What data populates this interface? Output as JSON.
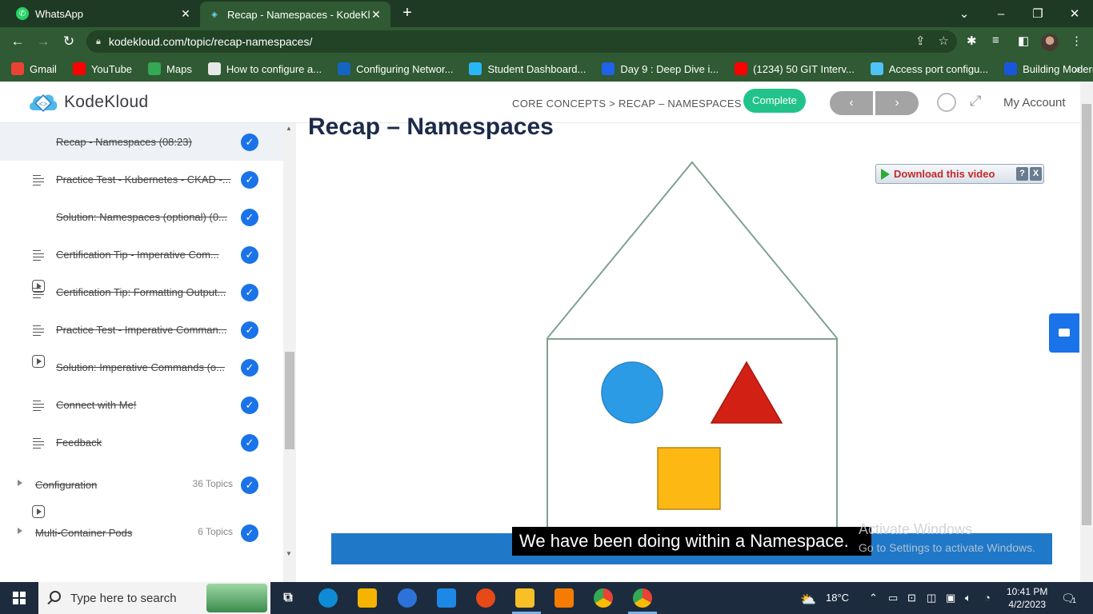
{
  "browser": {
    "tabs": [
      {
        "title": "WhatsApp",
        "icon": "whatsapp-icon",
        "active": false
      },
      {
        "title": "Recap - Namespaces - KodeKloud",
        "icon": "kodekloud-icon",
        "active": true
      }
    ],
    "url": "kodekloud.com/topic/recap-namespaces/",
    "bookmarks": [
      {
        "label": "Gmail",
        "icon": "gmail-icon",
        "color": "#ea4335"
      },
      {
        "label": "YouTube",
        "icon": "youtube-icon",
        "color": "#ff0000"
      },
      {
        "label": "Maps",
        "icon": "maps-icon",
        "color": "#34a853"
      },
      {
        "label": "How to configure a...",
        "icon": "bookmark-icon",
        "color": "#e8e8e8"
      },
      {
        "label": "Configuring Networ...",
        "icon": "vmware-icon",
        "color": "#1565c0"
      },
      {
        "label": "Student Dashboard...",
        "icon": "kodekloud-icon",
        "color": "#29b6f6"
      },
      {
        "label": "Day 9 : Deep Dive i...",
        "icon": "diamond-icon",
        "color": "#1e63e9"
      },
      {
        "label": "(1234) 50 GIT Interv...",
        "icon": "youtube-icon",
        "color": "#ff0000"
      },
      {
        "label": "Access port configu...",
        "icon": "cisco-icon",
        "color": "#4fc3f7"
      },
      {
        "label": "Building Modern Py...",
        "icon": "c-icon",
        "color": "#1a56db"
      }
    ]
  },
  "header": {
    "logo_text": "KodeKloud",
    "breadcrumb": "CORE CONCEPTS > RECAP – NAMESPACES",
    "complete_label": "Complete",
    "prev_label": "‹",
    "next_label": "›",
    "account_label": "My Account"
  },
  "sidebar": {
    "lessons": [
      {
        "title": "Recap - Namespaces (08:23)",
        "type": "video",
        "current": true
      },
      {
        "title": "Practice Test - Kubernetes - CKAD -...",
        "type": "text",
        "current": false
      },
      {
        "title": "Solution: Namespaces (optional) (0...",
        "type": "video",
        "current": false
      },
      {
        "title": "Certification Tip - Imperative Com...",
        "type": "text",
        "current": false
      },
      {
        "title": "Certification Tip: Formatting Output...",
        "type": "text",
        "current": false
      },
      {
        "title": "Practice Test - Imperative Comman...",
        "type": "text",
        "current": false
      },
      {
        "title": "Solution: Imperative Commands (o...",
        "type": "video",
        "current": false
      },
      {
        "title": "Connect with Me!",
        "type": "text",
        "current": false
      },
      {
        "title": "Feedback",
        "type": "text",
        "current": false
      }
    ],
    "sections": [
      {
        "title": "Configuration",
        "count": "36 Topics"
      },
      {
        "title": "Multi-Container Pods",
        "count": "6 Topics"
      }
    ]
  },
  "main": {
    "title": "Recap – Namespaces",
    "download_label": "Download this video",
    "help_label": "?",
    "close_label": "X",
    "subtitle": "We have been doing within a Namespace.",
    "watermark_line1": "Activate Windows",
    "watermark_line2": "Go to Settings to activate Windows."
  },
  "taskbar": {
    "search_placeholder": "Type here to search",
    "temperature": "18°C",
    "time": "10:41 PM",
    "date": "4/2/2023",
    "notification_count": "1"
  },
  "colors": {
    "chrome_dark": "#1f3a24",
    "chrome": "#2f5a33",
    "accent_green": "#22c38b",
    "check_blue": "#1a73e8",
    "video_bar": "#1f78c8",
    "shape_circle": "#2b9be6",
    "shape_triangle": "#d32014",
    "shape_square": "#fdb814",
    "house_stroke": "#7fa290"
  }
}
